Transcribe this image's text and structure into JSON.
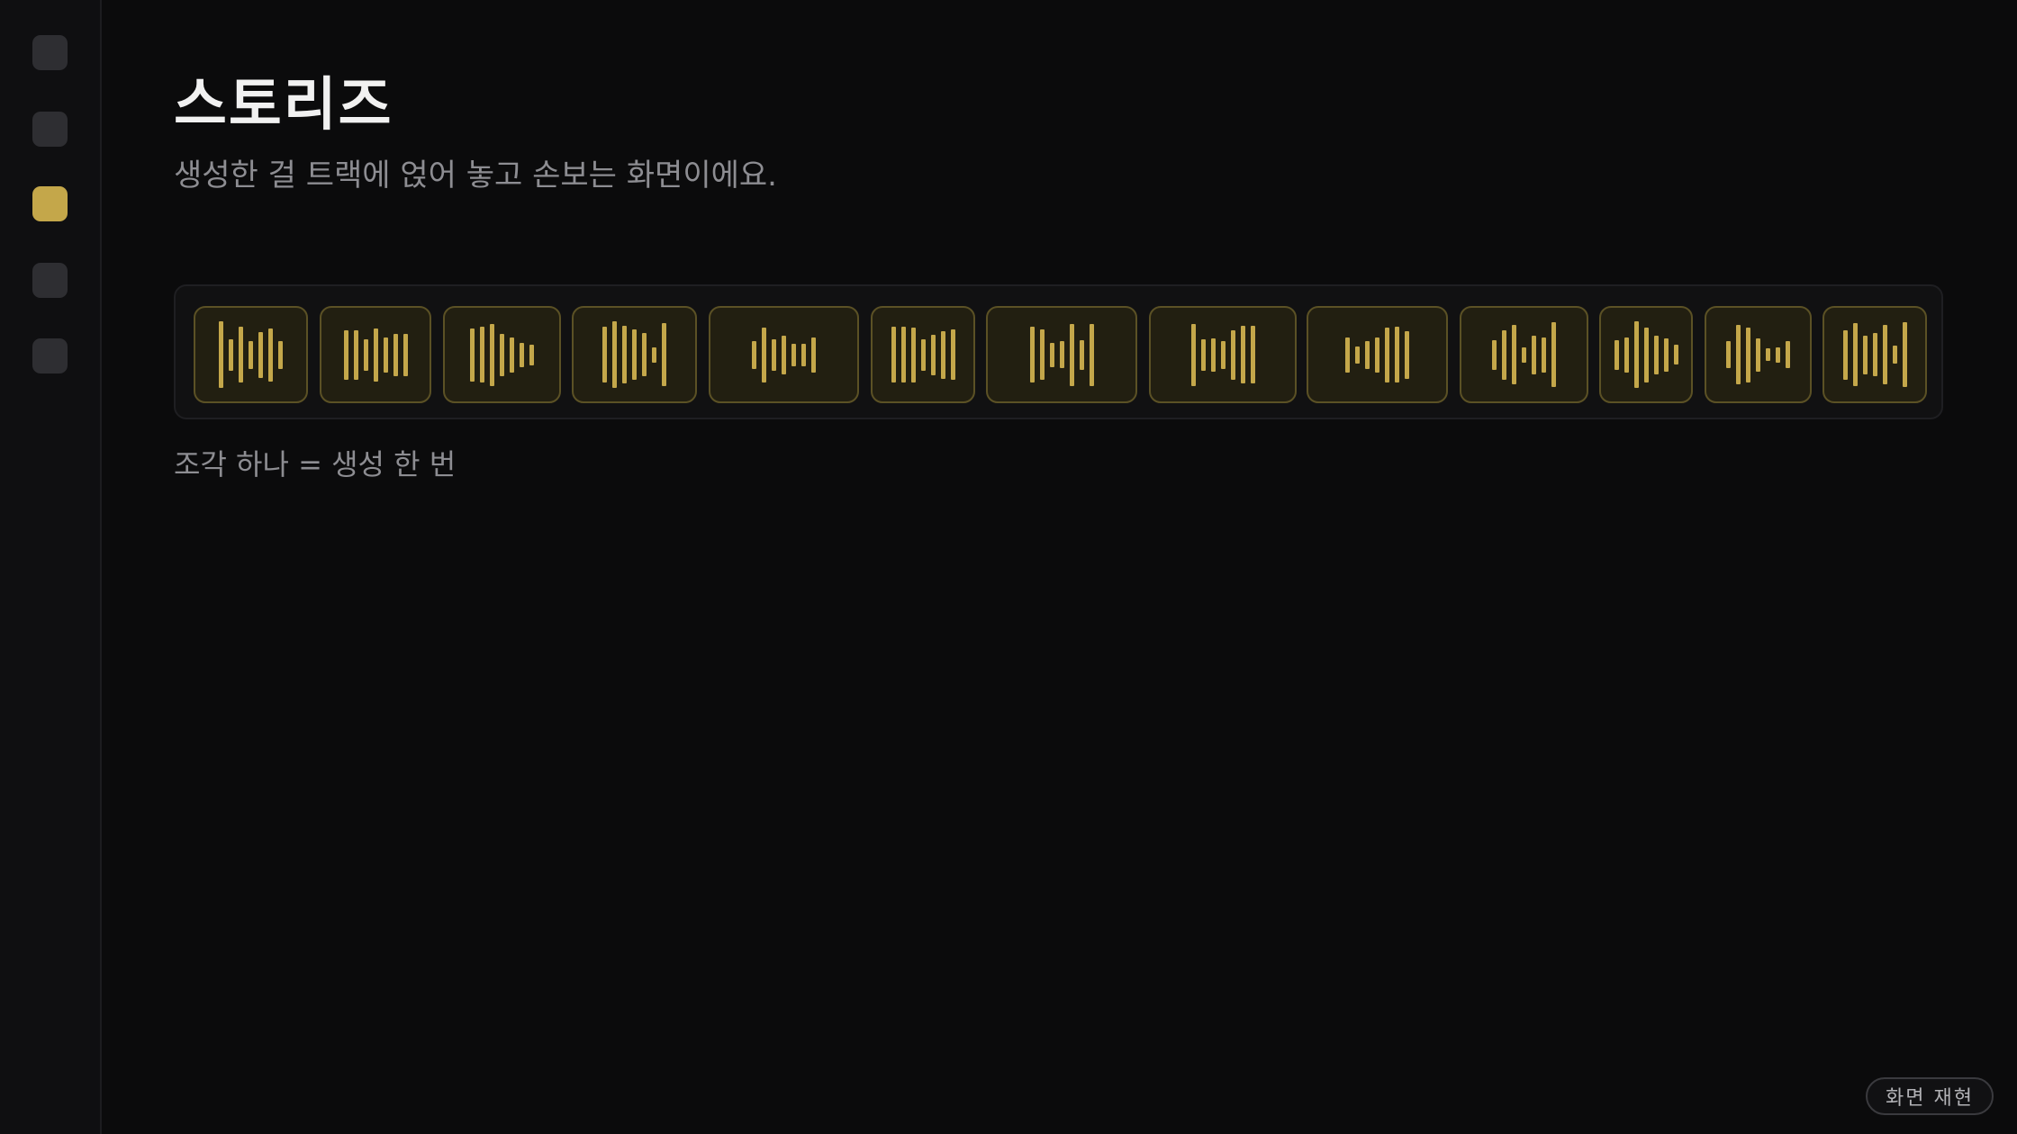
{
  "sidebar": {
    "items": [
      {
        "icon": "nav-item-icon",
        "active": false
      },
      {
        "icon": "nav-item-icon",
        "active": false
      },
      {
        "icon": "nav-item-icon",
        "active": true
      },
      {
        "icon": "nav-item-icon",
        "active": false
      },
      {
        "icon": "nav-item-icon",
        "active": false
      }
    ],
    "active_color": "#c4a74a",
    "inactive_color": "#2e2e32"
  },
  "header": {
    "title": "스토리즈",
    "subtitle": "생성한 걸 트랙에 얹어 놓고 손보는 화면이에요."
  },
  "track": {
    "clip_color": "#c4a74a",
    "clips": [
      {
        "waveform": [
          0.95,
          0.45,
          0.8,
          0.4,
          0.65,
          0.75,
          0.4
        ]
      },
      {
        "waveform": [
          0.7,
          0.7,
          0.45,
          0.75,
          0.5,
          0.6,
          0.6
        ]
      },
      {
        "waveform": [
          0.75,
          0.8,
          0.88,
          0.6,
          0.5,
          0.35,
          0.3
        ]
      },
      {
        "waveform": [
          0.8,
          0.95,
          0.82,
          0.72,
          0.62,
          0.22,
          0.9
        ]
      },
      {
        "waveform": [
          0.4,
          0.78,
          0.45,
          0.55,
          0.32,
          0.32,
          0.5
        ]
      },
      {
        "waveform": [
          0.8,
          0.8,
          0.78,
          0.45,
          0.58,
          0.68,
          0.72
        ]
      },
      {
        "waveform": [
          0.8,
          0.72,
          0.35,
          0.38,
          0.88,
          0.42,
          0.88
        ]
      },
      {
        "waveform": [
          0.88,
          0.45,
          0.48,
          0.4,
          0.7,
          0.82,
          0.82
        ]
      },
      {
        "waveform": [
          0.5,
          0.24,
          0.4,
          0.5,
          0.78,
          0.8,
          0.68
        ]
      },
      {
        "waveform": [
          0.42,
          0.7,
          0.85,
          0.22,
          0.55,
          0.5,
          0.92
        ]
      },
      {
        "waveform": [
          0.42,
          0.5,
          0.95,
          0.78,
          0.55,
          0.48,
          0.28
        ]
      },
      {
        "waveform": [
          0.38,
          0.85,
          0.78,
          0.48,
          0.18,
          0.22,
          0.38
        ]
      },
      {
        "waveform": [
          0.7,
          0.9,
          0.55,
          0.62,
          0.85,
          0.25,
          0.92
        ]
      }
    ]
  },
  "caption": "조각 하나 = 생성 한 번",
  "footer": {
    "replay_label": "화면 재현"
  }
}
